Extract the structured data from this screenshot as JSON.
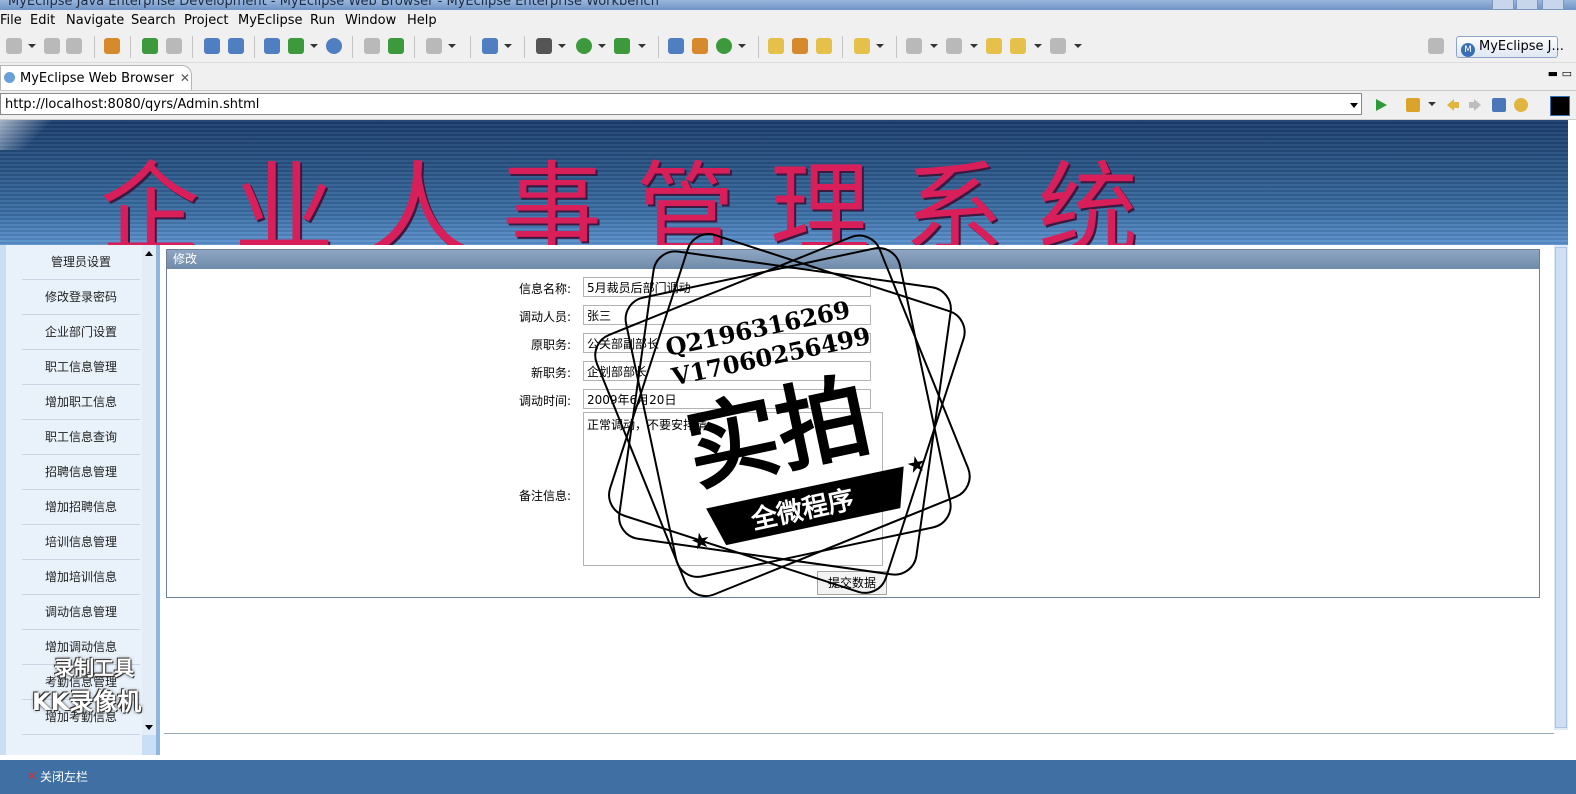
{
  "window": {
    "title": "MyEclipse Java Enterprise Development - MyEclipse Web Browser - MyEclipse Enterprise Workbench"
  },
  "menu": [
    "File",
    "Edit",
    "Navigate",
    "Search",
    "Project",
    "MyEclipse",
    "Run",
    "Window",
    "Help"
  ],
  "perspective": {
    "label": "MyEclipse J..."
  },
  "editor_tab": {
    "label": "MyEclipse Web Browser"
  },
  "browser": {
    "url": "http://localhost:8080/qyrs/Admin.shtml"
  },
  "banner": {
    "title": "企业人事管理系统"
  },
  "sidebar": {
    "items": [
      "管理员设置",
      "修改登录密码",
      "企业部门设置",
      "职工信息管理",
      "增加职工信息",
      "职工信息查询",
      "招聘信息管理",
      "增加招聘信息",
      "培训信息管理",
      "增加培训信息",
      "调动信息管理",
      "增加调动信息",
      "考勤信息管理",
      "增加考勤信息"
    ]
  },
  "form": {
    "panel_title": "修改",
    "fields": [
      {
        "label": "信息名称:",
        "value": "5月裁员后部门调动"
      },
      {
        "label": "调动人员:",
        "value": "张三"
      },
      {
        "label": "原职务:",
        "value": "公关部副部长"
      },
      {
        "label": "新职务:",
        "value": "企划部部长"
      },
      {
        "label": "调动时间:",
        "value": "2009年6月20日"
      }
    ],
    "remark_label": "备注信息:",
    "remark_value": "正常调动，不要安排请",
    "submit_label": "提交数据"
  },
  "footer": {
    "close_label": "关闭左栏",
    "close_icon": "close-x-icon"
  },
  "watermarks": {
    "recorder_line1": "录制工具",
    "recorder_line2": "KK录像机",
    "stamp_line1": "Q2196316269",
    "stamp_line2": "V17060256499",
    "stamp_main": "实拍",
    "stamp_sub": "全微程序"
  },
  "colors": {
    "banner_text": "#d81f5a",
    "sidebar_bg": "#e9f2fb",
    "panel_header": "#7c94b3",
    "bottom_bar": "#3f6fa3"
  }
}
